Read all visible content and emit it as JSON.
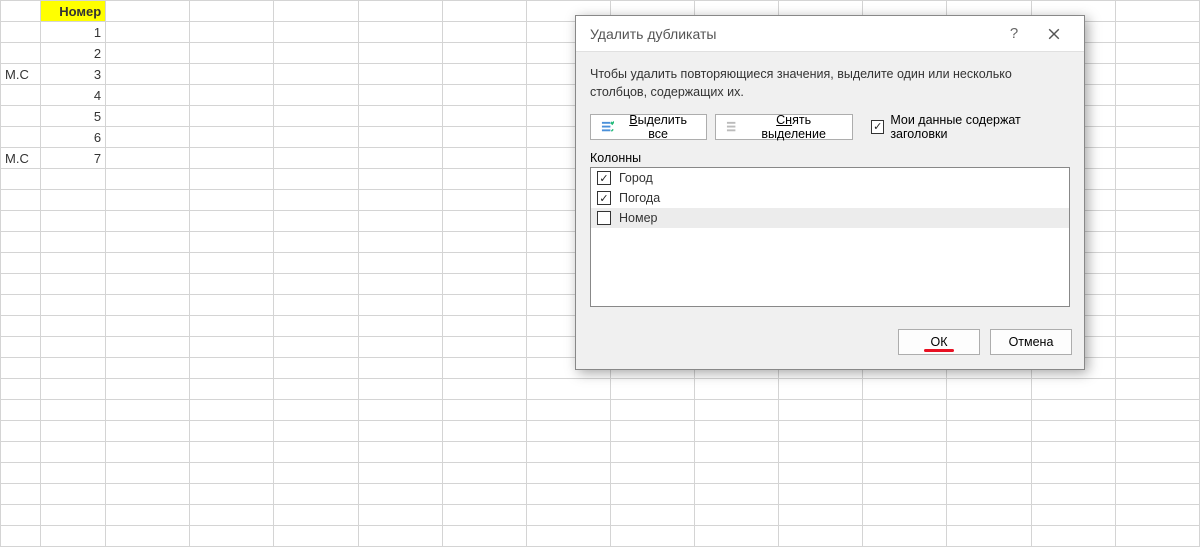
{
  "sheet": {
    "header": "Номер",
    "rows": [
      {
        "a": "",
        "b": "1"
      },
      {
        "a": "",
        "b": "2"
      },
      {
        "a": "М.С",
        "b": "3"
      },
      {
        "a": "",
        "b": "4"
      },
      {
        "a": "",
        "b": "5"
      },
      {
        "a": "",
        "b": "6"
      },
      {
        "a": "М.С",
        "b": "7"
      }
    ]
  },
  "dialog": {
    "title": "Удалить дубликаты",
    "help_icon": "?",
    "instructions": "Чтобы удалить повторяющиеся значения, выделите один или несколько столбцов, содержащих их.",
    "select_all": {
      "prefix": "В",
      "rest": "ыделить все"
    },
    "unselect_all": {
      "prefix": "Сн",
      "rest": "ять выделение"
    },
    "has_headers_label": "Мои данные содержат заголовки",
    "has_headers_checked": true,
    "columns_label": "Колонны",
    "columns": [
      {
        "label": "Город",
        "checked": true,
        "selected": false
      },
      {
        "label": "Погода",
        "checked": true,
        "selected": false
      },
      {
        "label": "Номер",
        "checked": false,
        "selected": true
      }
    ],
    "ok": "ОК",
    "cancel": "Отмена"
  }
}
